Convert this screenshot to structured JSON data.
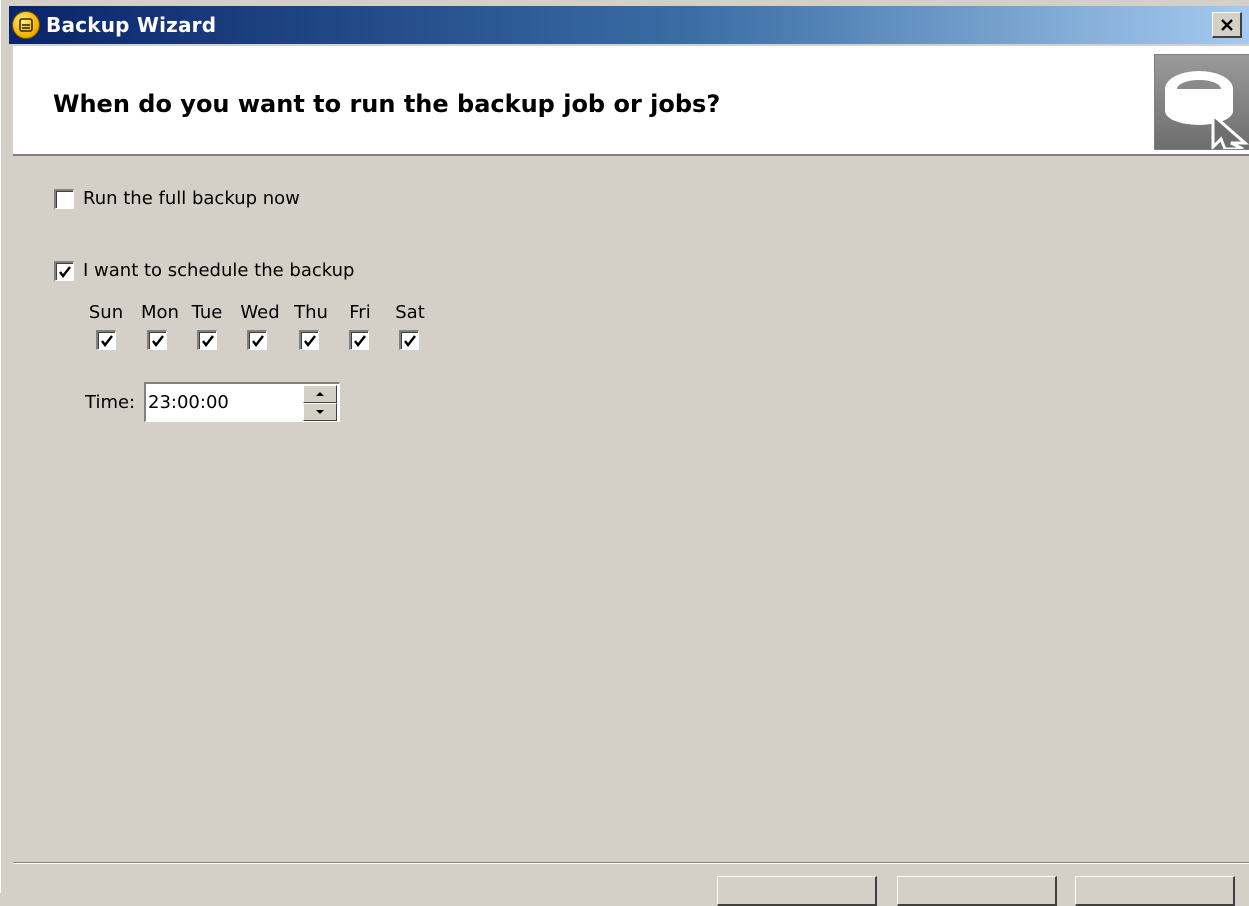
{
  "window": {
    "title": "Backup Wizard",
    "close_label": "×"
  },
  "header": {
    "title": "When do you want to run the backup job or jobs?"
  },
  "options": {
    "run_now": {
      "label": "Run the full backup now",
      "checked": false
    },
    "schedule": {
      "label": "I want to schedule the backup",
      "checked": true
    }
  },
  "days": [
    {
      "label": "Sun",
      "checked": true
    },
    {
      "label": "Mon",
      "checked": true
    },
    {
      "label": "Tue",
      "checked": true
    },
    {
      "label": "Wed",
      "checked": true
    },
    {
      "label": "Thu",
      "checked": true
    },
    {
      "label": "Fri",
      "checked": true
    },
    {
      "label": "Sat",
      "checked": true
    }
  ],
  "time": {
    "label": "Time:",
    "value": "23:00:00"
  },
  "footer": {
    "mid_label": "",
    "back_label": "",
    "next_label": "",
    "cancel_label": ""
  },
  "colors": {
    "title_gradient_start": "#0a246a",
    "title_gradient_end": "#a6caf0",
    "dialog_background": "#d4d0c8"
  },
  "icons": {
    "app_icon": "backup-disk-icon",
    "header_graphic": "tape-cursor-icon"
  }
}
